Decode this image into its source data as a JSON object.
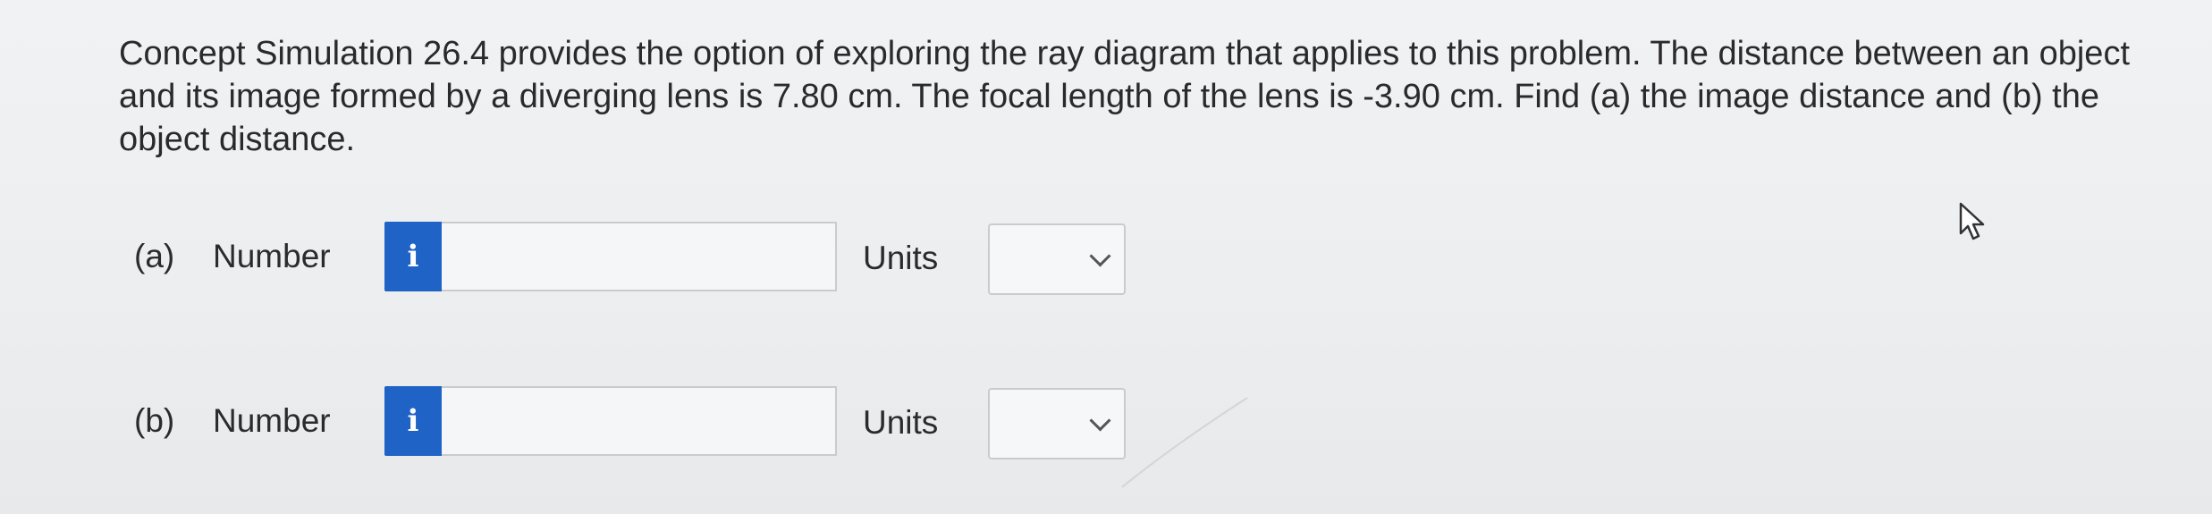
{
  "question": {
    "text": "Concept Simulation 26.4 provides the option of exploring the ray diagram that applies to this problem. The distance between an object and its image formed by a diverging lens is 7.80 cm. The focal length of the lens is -3.90 cm. Find (a) the image distance and (b) the object distance."
  },
  "parts": [
    {
      "label": "(a)",
      "number_label": "Number",
      "info_icon": "i",
      "number_value": "",
      "units_label": "Units",
      "units_selected": ""
    },
    {
      "label": "(b)",
      "number_label": "Number",
      "info_icon": "i",
      "number_value": "",
      "units_label": "Units",
      "units_selected": ""
    }
  ],
  "colors": {
    "info_button": "#1f63c6",
    "background": "#eceef0"
  },
  "icons": {
    "info": "info-icon",
    "dropdown": "chevron-down-icon",
    "cursor": "mouse-cursor-icon"
  }
}
